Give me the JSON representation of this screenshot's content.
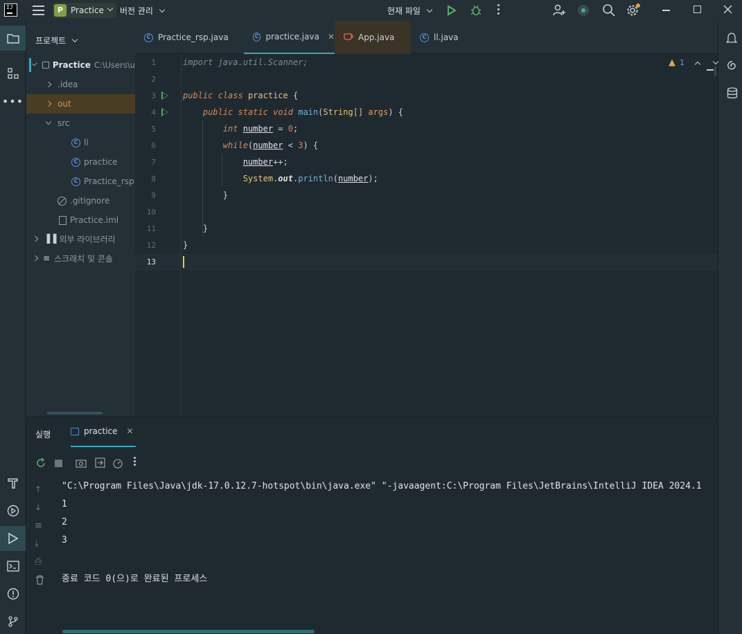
{
  "titlebar": {
    "project_letter": "P",
    "project_name": "Practice",
    "vcs_label": "버전 관리",
    "run_config": "현재 파일"
  },
  "project_panel": {
    "title": "프로젝트",
    "root_name": "Practice",
    "root_path": "C:\\Users\\u",
    "items": [
      {
        "label": ".idea"
      },
      {
        "label": "out"
      },
      {
        "label": "src"
      },
      {
        "label": "ll"
      },
      {
        "label": "practice"
      },
      {
        "label": "Practice_rsp"
      },
      {
        "label": ".gitignore"
      },
      {
        "label": "Practice.iml"
      },
      {
        "label": "외부 라이브러리"
      },
      {
        "label": "스크래치 및 콘솔"
      }
    ]
  },
  "tabs": [
    {
      "label": "Practice_rsp.java"
    },
    {
      "label": "practice.java"
    },
    {
      "label": "App.java"
    },
    {
      "label": "ll.java"
    }
  ],
  "editor": {
    "warning_count": "1",
    "line_numbers": [
      "1",
      "2",
      "3",
      "4",
      "5",
      "6",
      "7",
      "8",
      "9",
      "10",
      "11",
      "12",
      "13"
    ],
    "tokens": {
      "import_kw": "import",
      "import_path": " java.util.Scanner;",
      "public": "public",
      "class": "class",
      "class_name": "practice",
      "open_brace": " {",
      "static": "static",
      "void": "void",
      "main": "main",
      "string_arr": "String[]",
      "args": "args",
      "int": "int",
      "number": "number",
      "zero": "0",
      "while": "while",
      "three": "3",
      "system": "System",
      "out": "out",
      "println": "println",
      "close_brace": "}"
    }
  },
  "run_panel": {
    "title": "실행",
    "tab_label": "practice",
    "console_lines": [
      "\"C:\\Program Files\\Java\\jdk-17.0.12.7-hotspot\\bin\\java.exe\" \"-javaagent:C:\\Program Files\\JetBrains\\IntelliJ IDEA 2024.1",
      "1",
      "2",
      "3",
      "",
      "종료 코드 0(으)로 완료된 프로세스"
    ]
  },
  "colors": {
    "accent": "#3aa6c3",
    "run_green": "#59a869",
    "project_badge": "#7fa045",
    "highlight_out": "#4a3d26"
  }
}
